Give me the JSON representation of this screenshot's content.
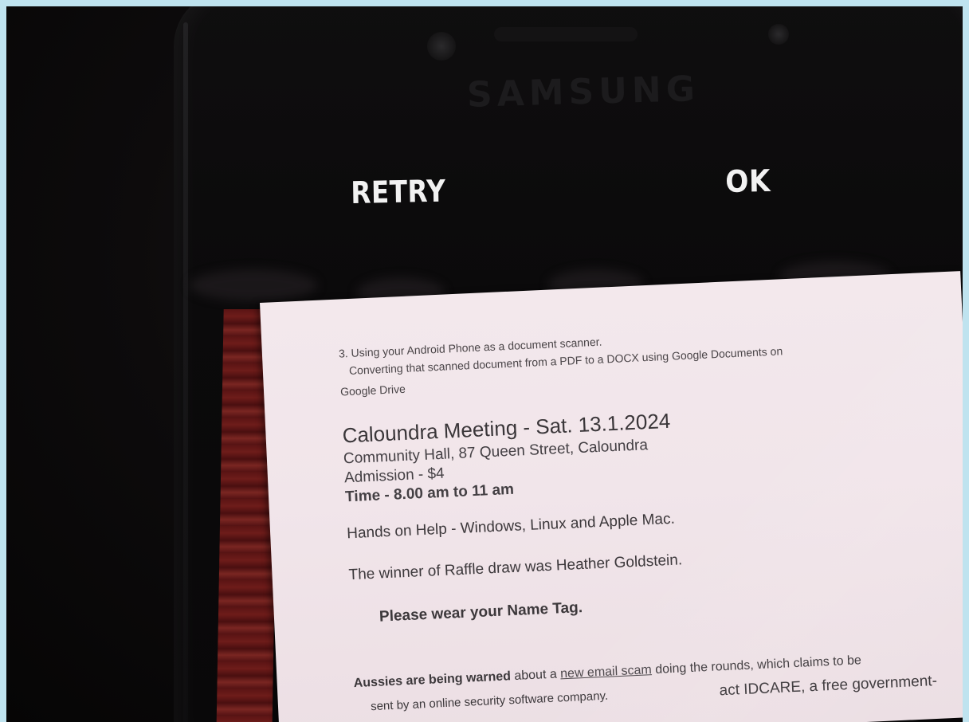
{
  "phone": {
    "brand": "SAMSUNG",
    "buttons": {
      "retry": "RETRY",
      "ok": "OK"
    }
  },
  "document": {
    "heading_line1": "3. Using your Android Phone as a document scanner.",
    "heading_line2": "Converting that scanned document from a PDF to a DOCX using Google Documents on",
    "heading_line3": "Google Drive",
    "meeting_title": "Caloundra Meeting - Sat. 13.1.2024",
    "venue": "Community Hall, 87 Queen Street, Caloundra",
    "admission": "Admission - $4",
    "time": "Time - 8.00 am to 11 am",
    "help": "Hands on Help - Windows, Linux and Apple Mac.",
    "raffle": "The winner of Raffle draw was Heather Goldstein.",
    "name_tag": "Please wear your Name Tag.",
    "warning_bold": "Aussies are being warned",
    "warning_text1": " about a ",
    "warning_link": "new email scam",
    "warning_text2": " doing the rounds, which claims to be",
    "partial_line1": "sent by an online security software company.",
    "partial_line2": "act IDCARE, a free government-"
  }
}
